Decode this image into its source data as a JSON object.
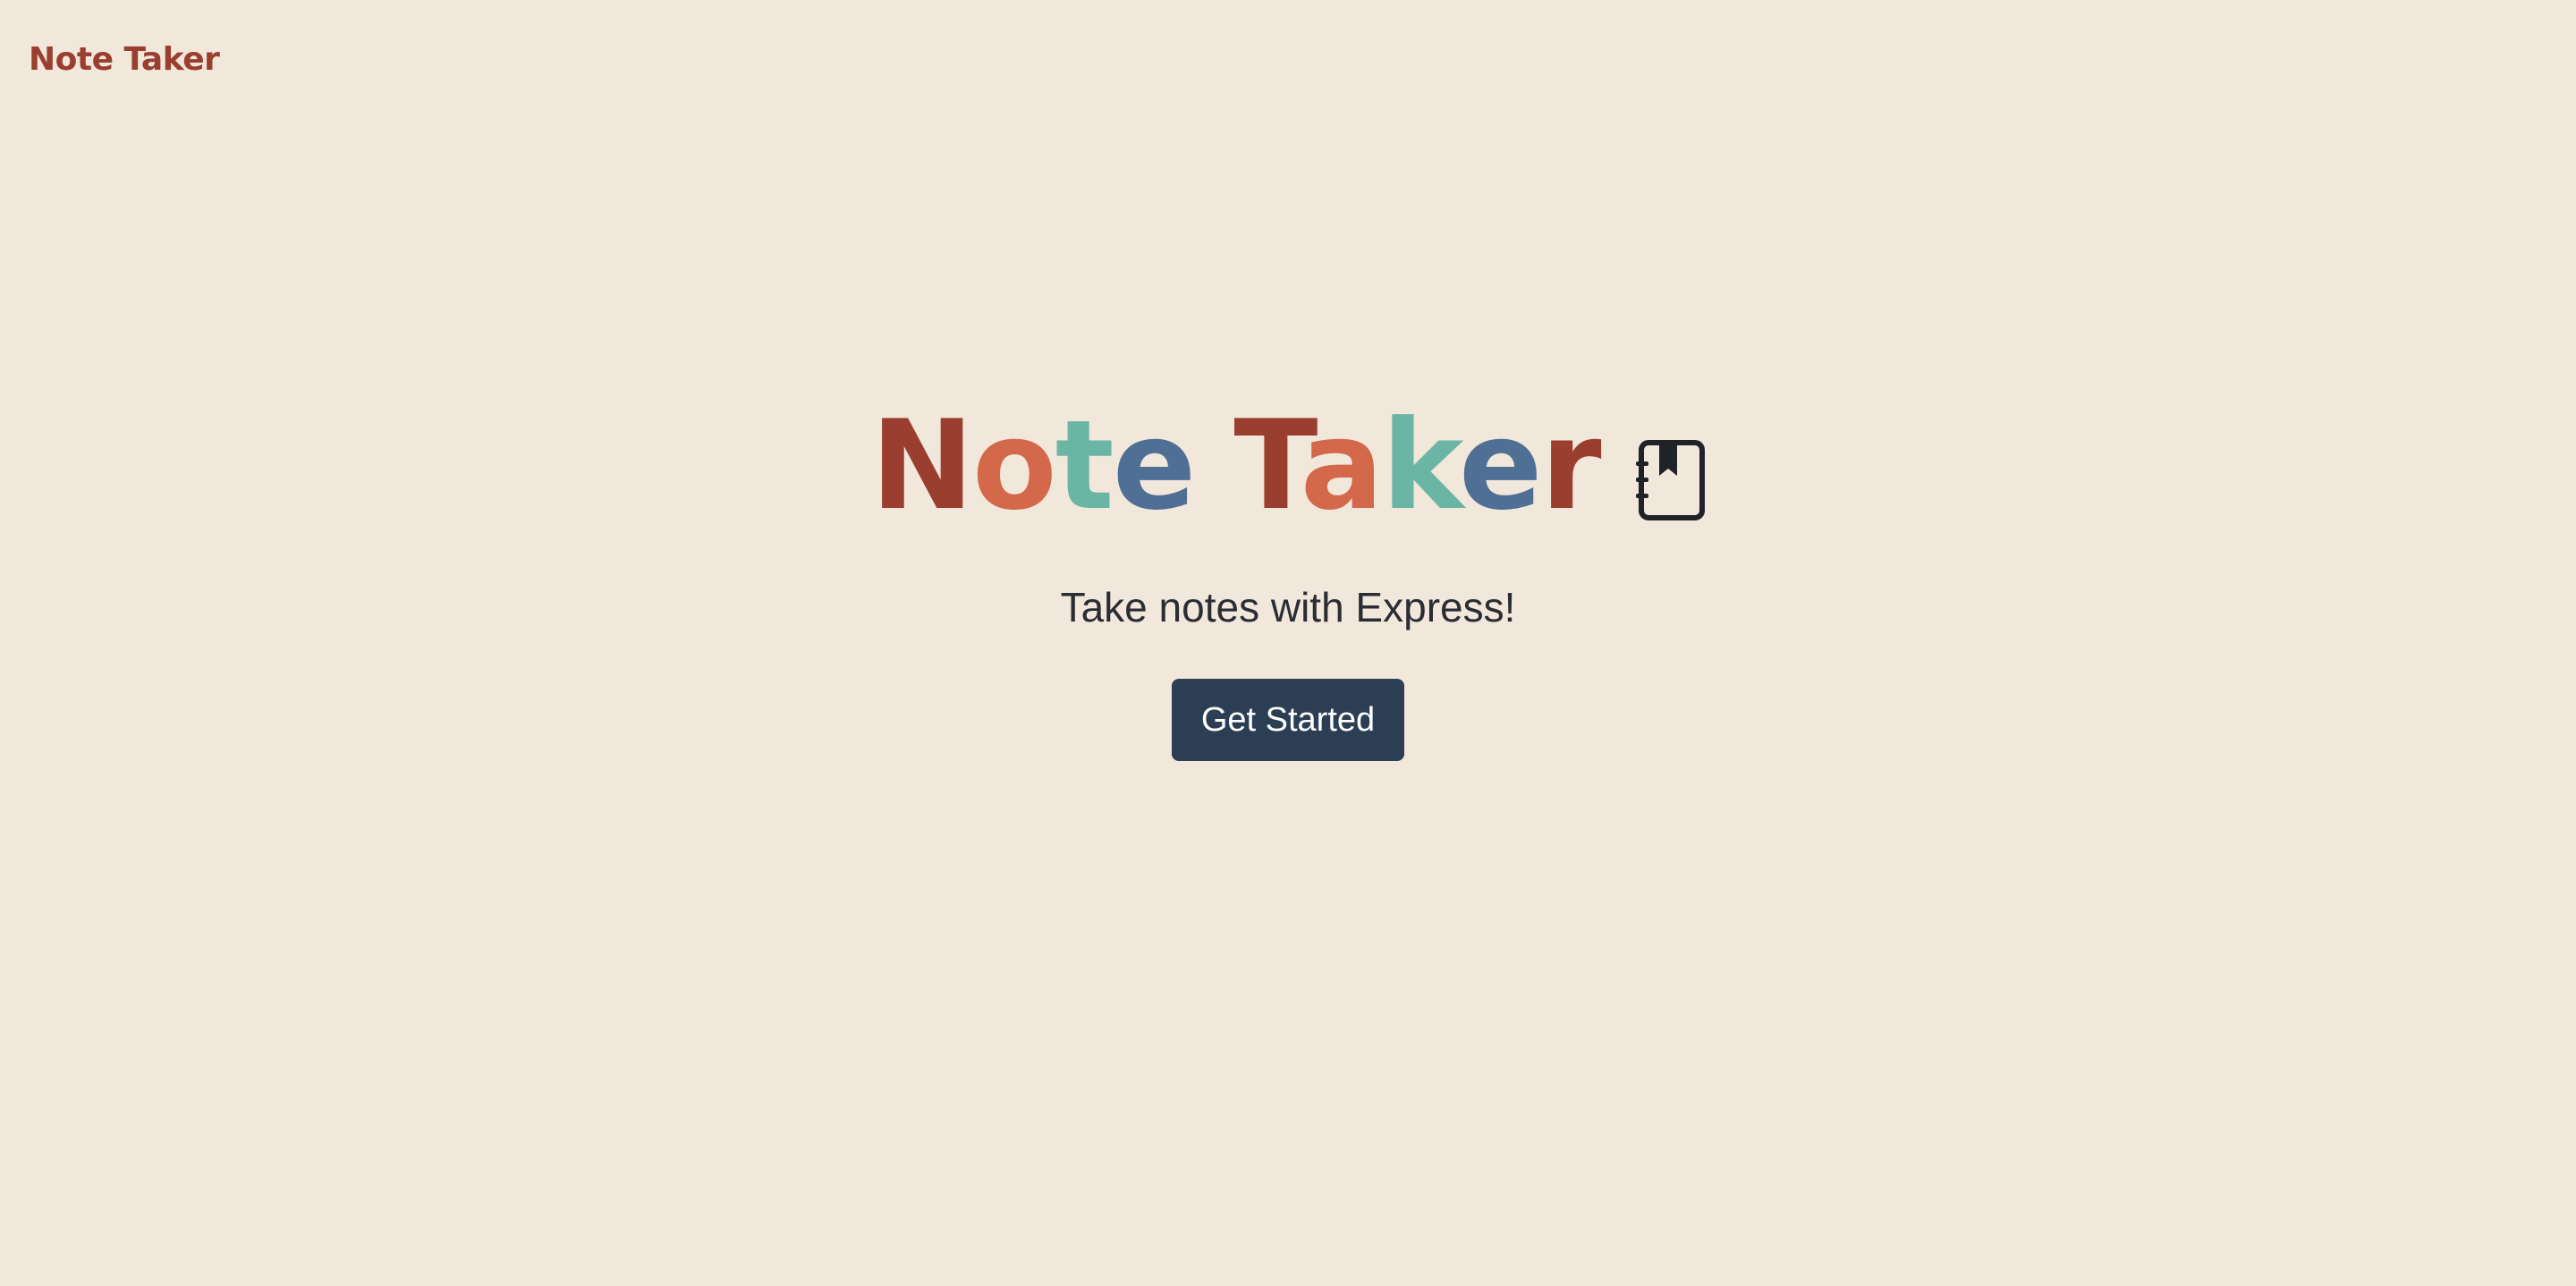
{
  "nav": {
    "brand": "Note Taker"
  },
  "hero": {
    "title_letters": [
      {
        "char": "N",
        "color": "#9a3f2f"
      },
      {
        "char": "o",
        "color": "#d4684a"
      },
      {
        "char": "t",
        "color": "#6bb5a5"
      },
      {
        "char": "e",
        "color": "#4f6f94"
      },
      {
        "char": " ",
        "color": ""
      },
      {
        "char": "T",
        "color": "#9a3f2f"
      },
      {
        "char": "a",
        "color": "#d4684a"
      },
      {
        "char": "k",
        "color": "#6bb5a5"
      },
      {
        "char": "e",
        "color": "#4f6f94"
      },
      {
        "char": "r",
        "color": "#9a3f2f"
      }
    ],
    "title_icon": "journal-bookmark-icon",
    "subtitle": "Take notes with Express!",
    "cta_label": "Get Started"
  },
  "colors": {
    "background": "#f1e7db",
    "brand": "#9a3f2f",
    "button": "#2c3e54",
    "text": "#2a2d33"
  }
}
